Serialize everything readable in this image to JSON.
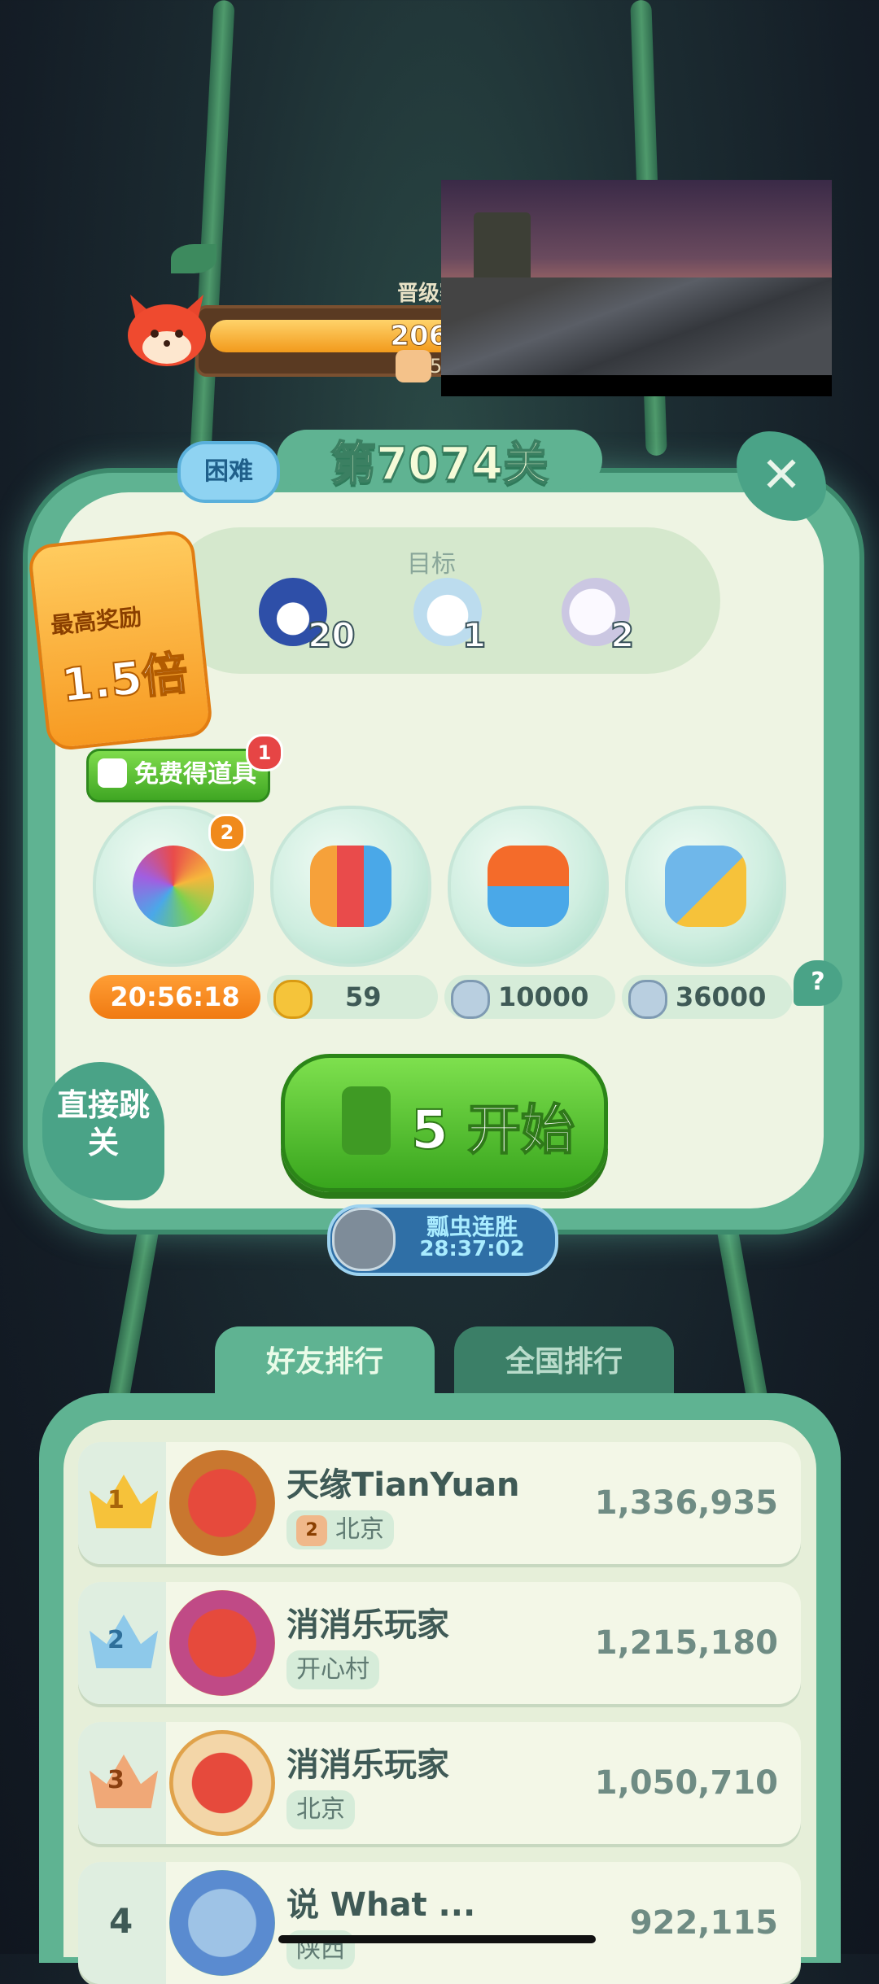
{
  "top_progress": {
    "title": "晋级赛",
    "value": "2069",
    "timer_prefix": "5"
  },
  "level": {
    "title": "第7074关",
    "difficulty": "困难",
    "close_label": "✕"
  },
  "goals": {
    "label": "目标",
    "items": [
      {
        "icon": "penguin-icon",
        "count": "20",
        "color": "#3c63c8"
      },
      {
        "icon": "polar-bear-icon",
        "count": "1",
        "color": "#cfe6f3"
      },
      {
        "icon": "seal-icon",
        "count": "2",
        "color": "#e7e5f2"
      }
    ]
  },
  "reward": {
    "line1": "最高奖励",
    "line2": "1.5倍"
  },
  "free_props": {
    "label": "免费得道具",
    "badge": "1"
  },
  "boosters": [
    {
      "icon": "owl-rainbow-icon",
      "badge": "2",
      "price": "20:56:18",
      "currency": "timer"
    },
    {
      "icon": "rocket-icon",
      "price": "59",
      "currency": "gold-coin-icon"
    },
    {
      "icon": "plus-three-moves-icon",
      "price": "10000",
      "currency": "silver-coin-icon"
    },
    {
      "icon": "hippo-chick-icon",
      "price": "36000",
      "currency": "silver-coin-icon"
    }
  ],
  "help_label": "?",
  "skip": {
    "label": "直接跳关"
  },
  "start": {
    "label": "5 开始"
  },
  "streak": {
    "title": "瓢虫连胜",
    "timer": "28:37:02"
  },
  "tabs": [
    {
      "label": "好友排行"
    },
    {
      "label": "全国排行"
    }
  ],
  "ranking": [
    {
      "rank": "1",
      "name": "天缘TianYuan",
      "level": "2",
      "location": "北京",
      "score": "1,336,935",
      "crown": "gold"
    },
    {
      "rank": "2",
      "name": "消消乐玩家",
      "location": "开心村",
      "score": "1,215,180",
      "crown": "silver"
    },
    {
      "rank": "3",
      "name": "消消乐玩家",
      "location": "北京",
      "score": "1,050,710",
      "crown": "bronze"
    },
    {
      "rank": "4",
      "name": "说 What ...",
      "location": "陕西",
      "score": "922,115",
      "crown": "none"
    }
  ],
  "colors": {
    "accent": "#5fb392",
    "panel": "#eef4e3",
    "start": "#4cba2a",
    "timer": "#f48a1c"
  }
}
